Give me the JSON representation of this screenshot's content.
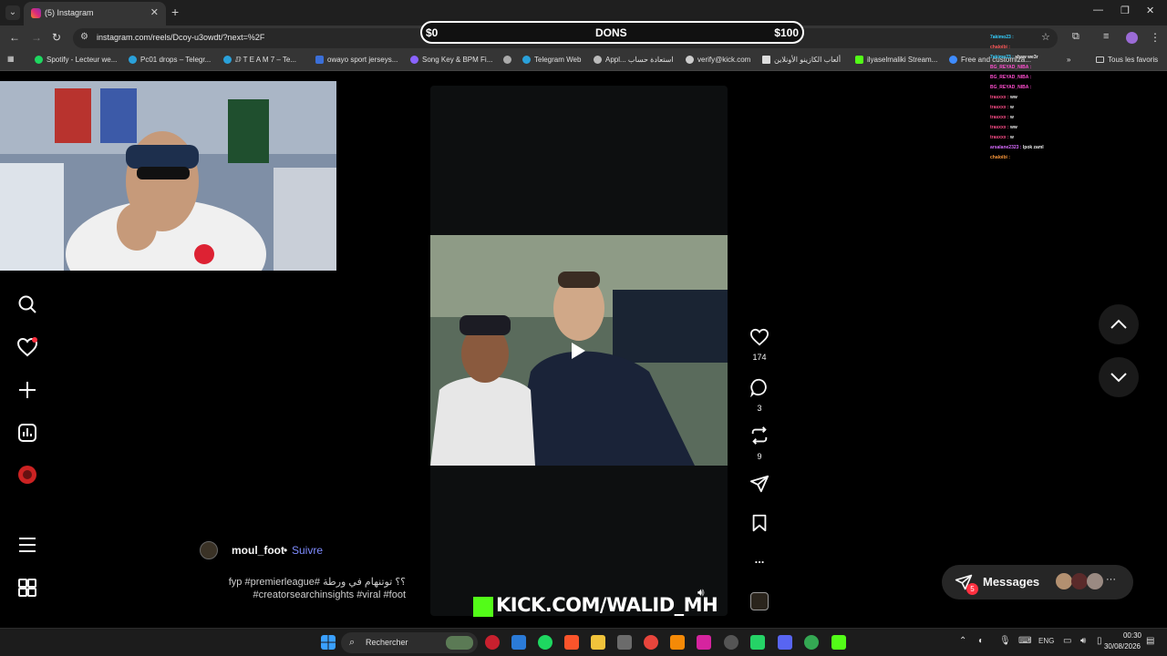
{
  "browser": {
    "tab_title": "(5) Instagram",
    "new_tab": "+",
    "url": "instagram.com/reels/Dcoy-u3owdt/?next=%2F",
    "bookmarks": [
      "Spotify - Lecteur we...",
      "Pc01 drops – Telegr...",
      "ⅅ T E A M 7 – Te...",
      "owayo sport jerseys...",
      "Song Key & BPM Fi...",
      "Telegram Web",
      "Appl... استعادة حساب",
      "verify@kick.com",
      "ألعاب الكازينو الأونلاين",
      "ilyaselmaliki Stream...",
      "Free and customiza..."
    ],
    "all_bookmarks": "Tous les favoris"
  },
  "donations": {
    "min": "$0",
    "label": "DONS",
    "max": "$100"
  },
  "chat": [
    {
      "user": "7akimo23 :",
      "msg": "",
      "color": "#35d0ff"
    },
    {
      "user": "chaloibi :",
      "msg": "",
      "color": "#ff5a5a"
    },
    {
      "user": "7akimo23 :",
      "msg": "shaw we3r",
      "color": "#35d0ff"
    },
    {
      "user": "BG_REYAD_NIBA :",
      "msg": "",
      "color": "#ff4fd0"
    },
    {
      "user": "BG_REYAD_NIBA :",
      "msg": "",
      "color": "#ff4fd0"
    },
    {
      "user": "BG_REYAD_NIBA :",
      "msg": "",
      "color": "#ff4fd0"
    },
    {
      "user": "trasxxx :",
      "msg": "ww",
      "color": "#ff4f8b"
    },
    {
      "user": "trasxxx :",
      "msg": "w",
      "color": "#ff4f8b"
    },
    {
      "user": "trasxxx :",
      "msg": "w",
      "color": "#ff4f8b"
    },
    {
      "user": "trasxxx :",
      "msg": "ww",
      "color": "#ff4f8b"
    },
    {
      "user": "trasxxx :",
      "msg": "w",
      "color": "#ff4f8b"
    },
    {
      "user": "arsalane2323 :",
      "msg": "lpok zaml",
      "color": "#d86cff"
    },
    {
      "user": "chaloibi :",
      "msg": "",
      "color": "#ff9a3c"
    }
  ],
  "reel": {
    "author": "moul_foot",
    "separator": "•",
    "follow": "Suivre",
    "caption_line1": "fyp #premierleague# ؟؟ توتنهام في ورطة",
    "caption_line2": "#creatorsearchinsights #viral #foot",
    "likes": "174",
    "comments": "3",
    "reposts": "9",
    "more": "..."
  },
  "overlay": {
    "kick_text": "KICK.COM/WALID_MH"
  },
  "messages": {
    "label": "Messages",
    "badge": "5",
    "more": "···"
  },
  "taskbar": {
    "search": "Rechercher",
    "lang": "ENG",
    "time": "00:30",
    "date": "30/08/2026"
  },
  "colors": {
    "instagram_blue": "#7f8cff",
    "kick_green": "#53fc18",
    "notif_red": "#ff3040"
  }
}
